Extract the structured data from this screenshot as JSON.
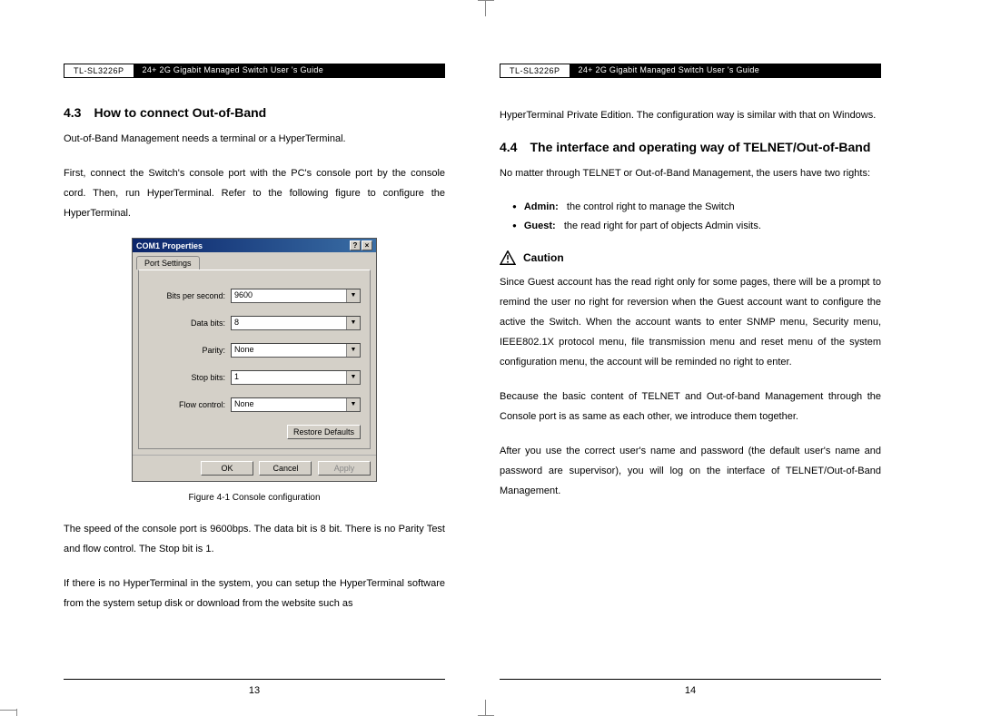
{
  "header": {
    "model": "TL-SL3226P",
    "title": "24+ 2G Gigabit Managed Switch User 's Guide"
  },
  "left": {
    "section_num": "4.3",
    "section_title": "How to connect Out-of-Band",
    "p1": "Out-of-Band Management needs a terminal or a HyperTerminal.",
    "p2": "First, connect the Switch's console port with the PC's console port by the console cord. Then, run HyperTerminal. Refer to the following figure to configure the HyperTerminal.",
    "dialog": {
      "title": "COM1 Properties",
      "tab": "Port Settings",
      "rows": {
        "bps_label": "Bits per second:",
        "bps_value": "9600",
        "data_label": "Data bits:",
        "data_value": "8",
        "parity_label": "Parity:",
        "parity_value": "None",
        "stop_label": "Stop bits:",
        "stop_value": "1",
        "flow_label": "Flow control:",
        "flow_value": "None"
      },
      "restore_btn": "Restore Defaults",
      "ok_btn": "OK",
      "cancel_btn": "Cancel",
      "apply_btn": "Apply"
    },
    "fig_caption": "Figure 4-1 Console configuration",
    "p3": "The speed of the console port is 9600bps. The data bit is 8 bit. There is no Parity Test and flow control. The Stop bit is 1.",
    "p4": "If there is no HyperTerminal in the system, you can setup the HyperTerminal software from the system setup disk or download from the website such as",
    "page_num": "13"
  },
  "right": {
    "p0": "HyperTerminal Private Edition. The configuration way is similar with that on Windows.",
    "section_num": "4.4",
    "section_title": "The interface and operating way of TELNET/Out-of-Band",
    "p1": "No matter through TELNET or Out-of-Band Management, the users have two rights:",
    "bullets": {
      "admin_label": "Admin:",
      "admin_text": "the control right to manage the Switch",
      "guest_label": "Guest:",
      "guest_text": "the read right for part of objects Admin visits."
    },
    "caution_label": "Caution",
    "p2": "Since Guest account has the read right only for some pages, there will be a prompt to remind the user no right for reversion when the Guest account want to configure the active the Switch. When the account wants to enter SNMP menu, Security menu, IEEE802.1X protocol menu, file transmission menu and reset menu of the system configuration menu, the account will be reminded no right to enter.",
    "p3": "Because the basic content of TELNET and Out-of-band Management through the Console port is as same as each other, we introduce them together.",
    "p4": "After you use the correct user's name and password (the default user's name and password are supervisor), you will log on the interface of TELNET/Out-of-Band Management.",
    "page_num": "14"
  }
}
